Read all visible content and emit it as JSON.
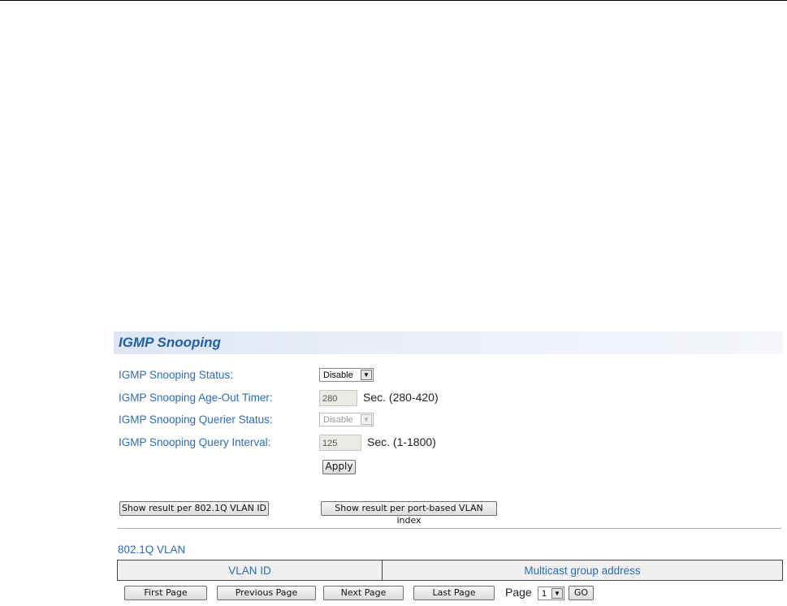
{
  "title": "IGMP Snooping",
  "fields": [
    {
      "label": "IGMP Snooping Status:",
      "value": "Disable"
    },
    {
      "label": "IGMP Snooping Age-Out Timer:",
      "value": "280",
      "unit": "Sec. (280-420)"
    },
    {
      "label": "IGMP Snooping Querier Status:",
      "value": "Disable"
    },
    {
      "label": "IGMP Snooping Query Interval:",
      "value": "125",
      "unit": "Sec. (1-1800)"
    }
  ],
  "apply": "Apply",
  "show_vlan_id": "Show result per 802.1Q VLAN ID",
  "show_port_based": "Show result per port-based VLAN index",
  "section": "802.1Q VLAN",
  "table": {
    "columns": [
      "VLAN ID",
      "Multicast group address"
    ]
  },
  "pagination": {
    "first": "First Page",
    "previous": "Previous Page",
    "next": "Next Page",
    "last": "Last Page",
    "page_label": "Page",
    "page": "1",
    "go": "GO"
  }
}
